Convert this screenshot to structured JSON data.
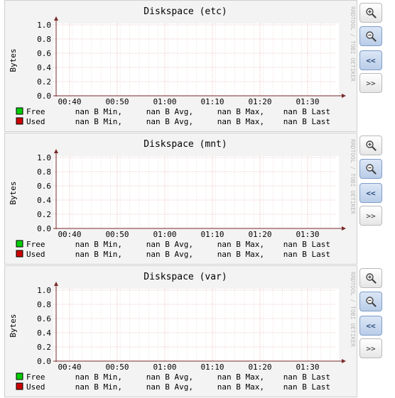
{
  "graphs": [
    {
      "id": "etc",
      "title": "Diskspace (etc)",
      "y_axis_label": "Bytes",
      "side_label": "RRDTOOL / TOBI OETIKER",
      "y_ticks": [
        "1.0",
        "0.8",
        "0.6",
        "0.4",
        "0.2",
        "0.0"
      ],
      "x_ticks": [
        "00:40",
        "00:50",
        "01:00",
        "01:10",
        "01:20",
        "01:30"
      ],
      "legend": [
        {
          "name": "Free",
          "color": "#00cc00",
          "min": "nan B Min,",
          "avg": "nan B Avg,",
          "max": "nan B Max,",
          "last": "nan B Last"
        },
        {
          "name": "Used",
          "color": "#cc0000",
          "min": "nan B Min,",
          "avg": "nan B Avg,",
          "max": "nan B Max,",
          "last": "nan B Last"
        }
      ]
    },
    {
      "id": "mnt",
      "title": "Diskspace (mnt)",
      "y_axis_label": "Bytes",
      "side_label": "RRDTOOL / TOBI OETIKER",
      "y_ticks": [
        "1.0",
        "0.8",
        "0.6",
        "0.4",
        "0.2",
        "0.0"
      ],
      "x_ticks": [
        "00:40",
        "00:50",
        "01:00",
        "01:10",
        "01:20",
        "01:30"
      ],
      "legend": [
        {
          "name": "Free",
          "color": "#00cc00",
          "min": "nan B Min,",
          "avg": "nan B Avg,",
          "max": "nan B Max,",
          "last": "nan B Last"
        },
        {
          "name": "Used",
          "color": "#cc0000",
          "min": "nan B Min,",
          "avg": "nan B Avg,",
          "max": "nan B Max,",
          "last": "nan B Last"
        }
      ]
    },
    {
      "id": "var",
      "title": "Diskspace (var)",
      "y_axis_label": "Bytes",
      "side_label": "RRDTOOL / TOBI OETIKER",
      "y_ticks": [
        "1.0",
        "0.8",
        "0.6",
        "0.4",
        "0.2",
        "0.0"
      ],
      "x_ticks": [
        "00:40",
        "00:50",
        "01:00",
        "01:10",
        "01:20",
        "01:30"
      ],
      "legend": [
        {
          "name": "Free",
          "color": "#00cc00",
          "min": "nan B Min,",
          "avg": "nan B Avg,",
          "max": "nan B Max,",
          "last": "nan B Last"
        },
        {
          "name": "Used",
          "color": "#cc0000",
          "min": "nan B Min,",
          "avg": "nan B Avg,",
          "max": "nan B Max,",
          "last": "nan B Last"
        }
      ]
    }
  ],
  "controls": [
    {
      "name": "zoom-in-button",
      "icon": "zoom-in-icon",
      "label": "",
      "active": false
    },
    {
      "name": "zoom-out-button",
      "icon": "zoom-out-icon",
      "label": "",
      "active": true
    },
    {
      "name": "previous-button",
      "icon": "",
      "label": "<<",
      "active": true
    },
    {
      "name": "next-button",
      "icon": "",
      "label": ">>",
      "active": false
    }
  ],
  "colors": {
    "grid_major": "#e7b0b0",
    "grid_minor": "#eecccc",
    "axis": "#7a2a2a",
    "panel_bg": "#f3f3f3",
    "plot_bg": "#ffffff"
  }
}
